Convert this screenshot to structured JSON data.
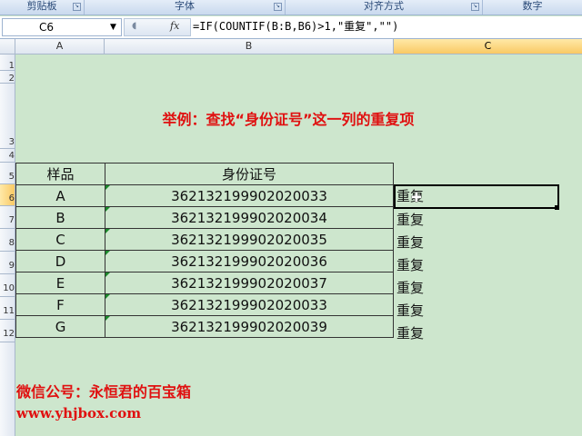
{
  "ribbon": {
    "groups": [
      "剪贴板",
      "字体",
      "对齐方式",
      "数字"
    ]
  },
  "formula_bar": {
    "name_box": "C6",
    "fx_label": "fx",
    "formula": "=IF(COUNTIF(B:B,B6)>1,\"重复\",\"\")"
  },
  "columns": [
    "A",
    "B",
    "C"
  ],
  "rows": [
    "1",
    "2",
    "3",
    "4",
    "5",
    "6",
    "7",
    "8",
    "9",
    "10",
    "11",
    "12"
  ],
  "sheet": {
    "title": "举例：查找“身份证号”这一列的重复项",
    "table": {
      "headers": [
        "样品",
        "身份证号"
      ],
      "rows": [
        {
          "a": "A",
          "b": "362132199902020033",
          "c": "重复"
        },
        {
          "a": "B",
          "b": "362132199902020034",
          "c": "重复"
        },
        {
          "a": "C",
          "b": "362132199902020035",
          "c": "重复"
        },
        {
          "a": "D",
          "b": "362132199902020036",
          "c": "重复"
        },
        {
          "a": "E",
          "b": "362132199902020037",
          "c": "重复"
        },
        {
          "a": "F",
          "b": "362132199902020033",
          "c": "重复"
        },
        {
          "a": "G",
          "b": "362132199902020039",
          "c": "重复"
        }
      ]
    },
    "footer_line1": "微信公号：永恒君的百宝箱",
    "footer_line2": "www.yhjbox.com"
  },
  "colors": {
    "accent_red": "#e01010",
    "grid_bg": "#cde6cd"
  }
}
